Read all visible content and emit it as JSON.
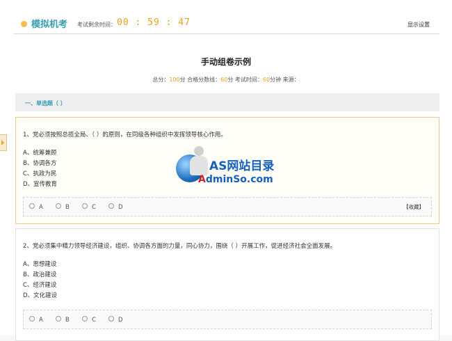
{
  "header": {
    "app_title": "模拟机考",
    "timer_label": "考试剩余时间：",
    "timer_value": "00 : 59 : 47",
    "settings_label": "显示设置"
  },
  "paper": {
    "title": "手动组卷示例",
    "meta": {
      "total_label": "总分：",
      "total_value": "100",
      "total_unit": "分 合格分数线：",
      "pass_value": "60",
      "pass_unit": "分 考试时间：",
      "time_value": "60",
      "time_unit": "分钟 来源："
    }
  },
  "section": {
    "title": "一、单选题（ ）"
  },
  "questions": [
    {
      "text": "1、党必须按照总揽全局、（ ）的原则，在同级各种组织中发挥领导核心作用。",
      "options": [
        "A、统筹兼顾",
        "B、协调各方",
        "C、执政为民",
        "D、宣传教育"
      ],
      "choices": [
        "A",
        "B",
        "C",
        "D"
      ],
      "favorite_label": "【收藏】"
    },
    {
      "text": "2、党必须集中精力领导经济建设，组织、协调各方面的力量，同心协力，围绕（ ）开展工作，促进经济社会全面发展。",
      "options": [
        "A、思想建设",
        "B、政治建设",
        "C、经济建设",
        "D、文化建设"
      ],
      "choices": [
        "A",
        "B",
        "C",
        "D"
      ]
    }
  ],
  "watermark": {
    "title": "AS网站目录",
    "sub_red": "A",
    "sub_blue": "dminSo.com"
  },
  "colors": {
    "accent_blue": "#3a9fb5",
    "accent_orange": "#f0a020"
  }
}
